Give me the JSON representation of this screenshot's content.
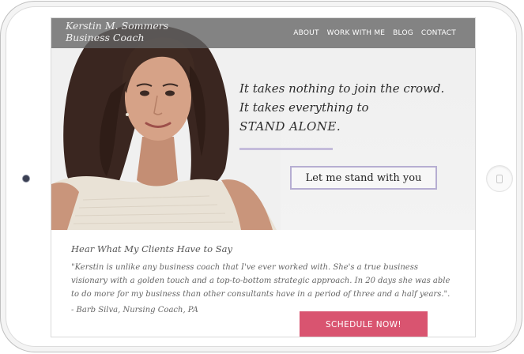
{
  "site": {
    "brand_line1": "Kerstin M. Sommers",
    "brand_line2": "Business Coach"
  },
  "nav": {
    "items": [
      "ABOUT",
      "WORK WITH ME",
      "BLOG",
      "CONTACT"
    ]
  },
  "hero": {
    "quote_line1": "It takes nothing to join the crowd.",
    "quote_line2": "It takes everything to",
    "quote_line3": "STAND ALONE.",
    "cta_label": "Let me stand with you"
  },
  "testimonial": {
    "heading": "Hear What My Clients Have to Say",
    "line1": "\"Kerstin is unlike any business coach that I've ever worked with. She's a true business",
    "line2": "visionary with a golden touch and a top-to-bottom strategic approach. In 20 days she was able",
    "line3": "to do more for my business than other consultants have in a period of three and a half years.\".",
    "author": "- Barb Silva, Nursing Coach, PA"
  },
  "schedule": {
    "label": "SCHEDULE NOW!"
  },
  "colors": {
    "accent_pink": "#d95470",
    "accent_lavender": "#b6aed2",
    "nav_bg": "#646464"
  }
}
